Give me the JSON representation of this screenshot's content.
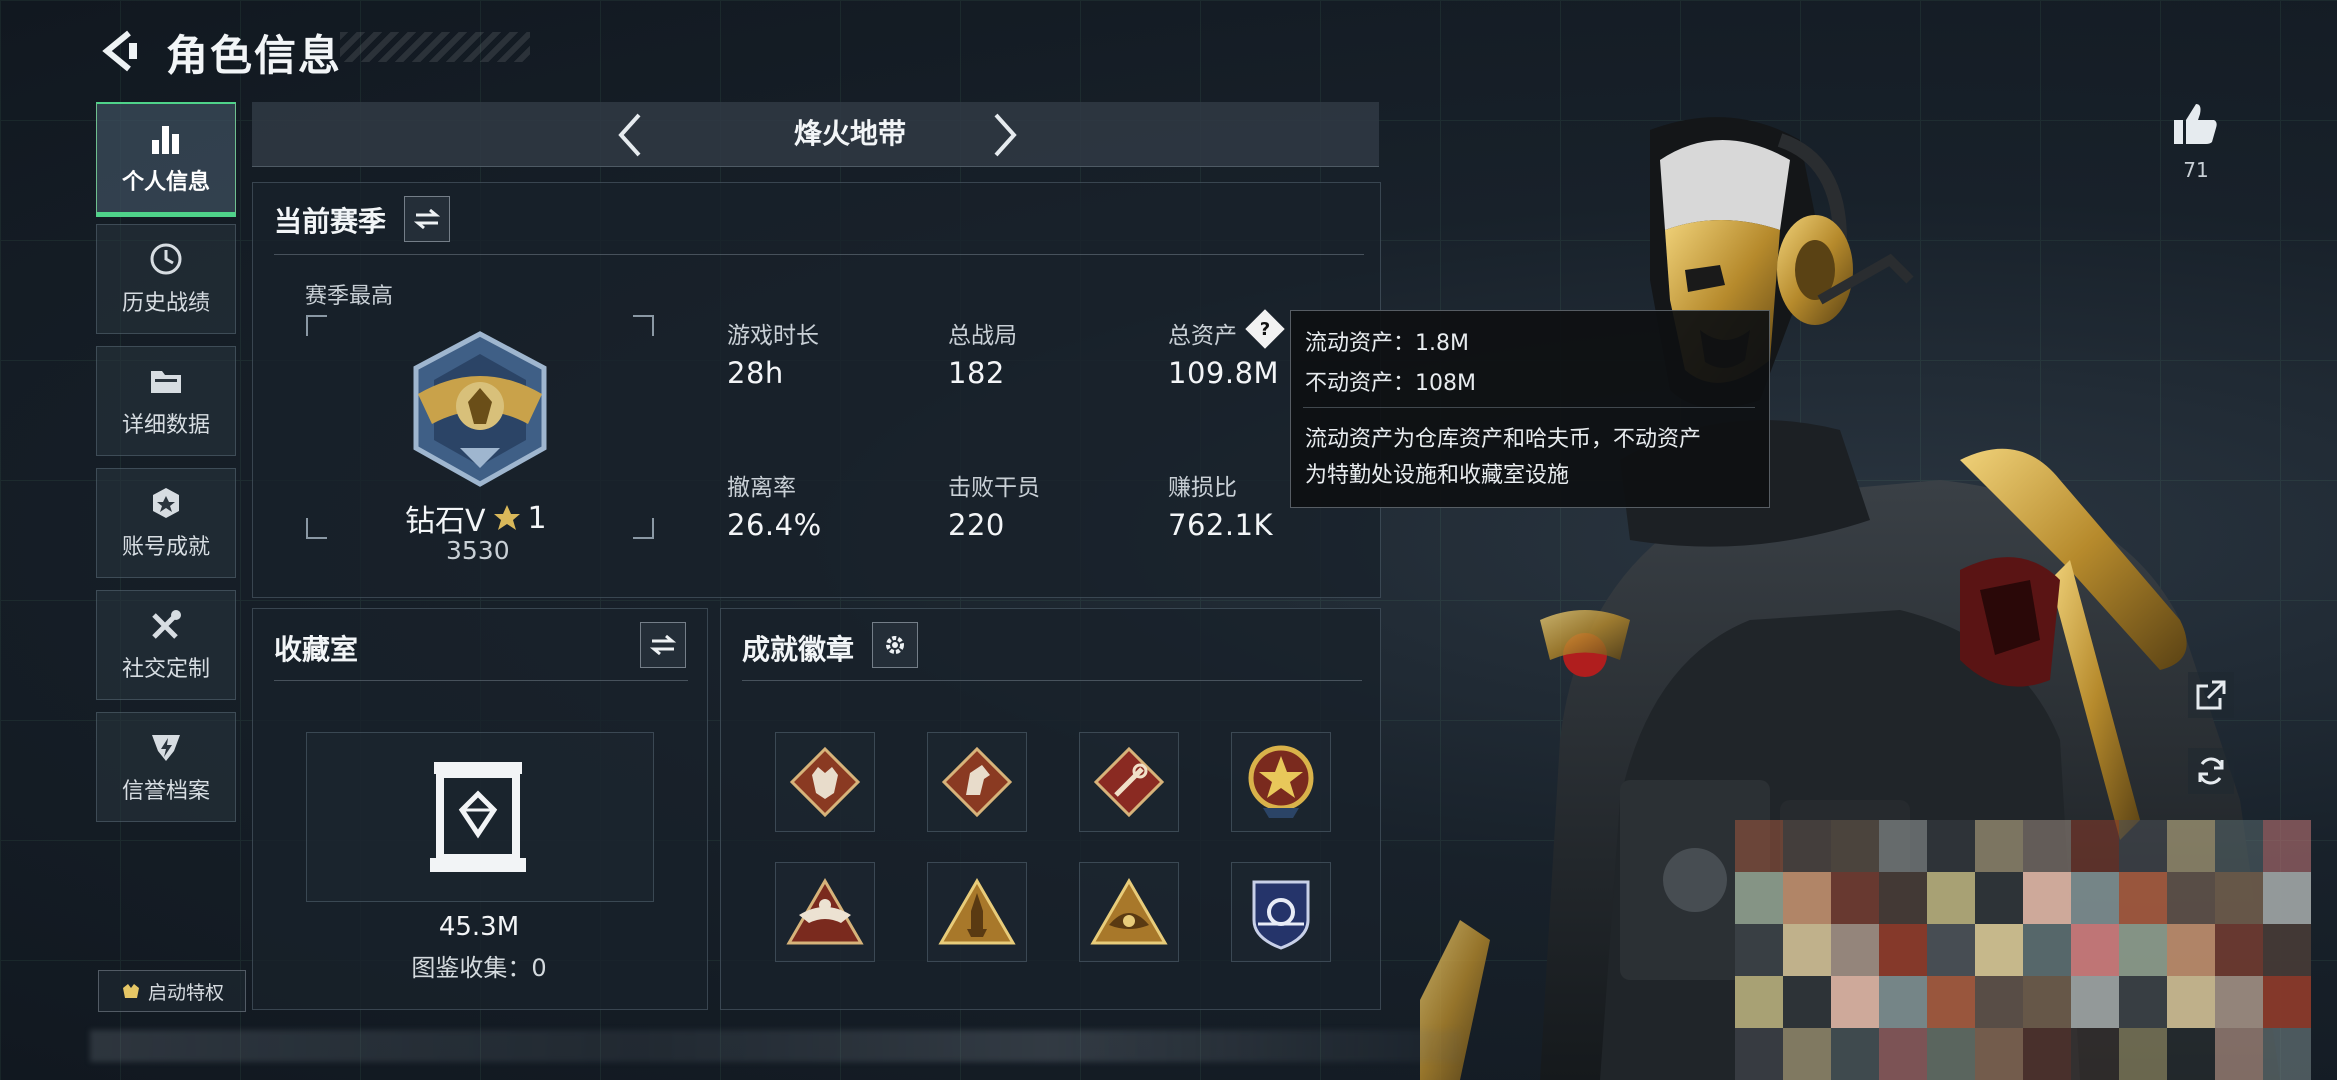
{
  "header": {
    "title": "角色信息"
  },
  "sidebar": {
    "items": [
      {
        "label": "个人信息",
        "icon": "bar-chart-icon",
        "active": true
      },
      {
        "label": "历史战绩",
        "icon": "history-clock-icon",
        "active": false
      },
      {
        "label": "详细数据",
        "icon": "folder-icon",
        "active": false
      },
      {
        "label": "账号成就",
        "icon": "achievement-icon",
        "active": false
      },
      {
        "label": "社交定制",
        "icon": "tools-icon",
        "active": false
      },
      {
        "label": "信誉档案",
        "icon": "reputation-icon",
        "active": false
      }
    ],
    "privilege_label": "启动特权"
  },
  "mode": {
    "label": "烽火地带"
  },
  "season": {
    "title": "当前赛季",
    "best_label": "赛季最高",
    "rank_name": "钻石V",
    "rank_stars": "1",
    "rank_points": "3530",
    "stats": [
      {
        "label": "游戏时长",
        "value": "28h"
      },
      {
        "label": "总战局",
        "value": "182"
      },
      {
        "label": "总资产",
        "value": "109.8M"
      },
      {
        "label": "撤离率",
        "value": "26.4%"
      },
      {
        "label": "击败干员",
        "value": "220"
      },
      {
        "label": "赚损比",
        "value": "762.1K"
      }
    ]
  },
  "tooltip": {
    "liquid": "流动资产：1.8M",
    "fixed": "不动资产：108M",
    "desc_line1": "流动资产为仓库资产和哈夫币，不动资产",
    "desc_line2": "为特勤处设施和收藏室设施"
  },
  "collection": {
    "title": "收藏室",
    "value": "45.3M",
    "catalog": "图鉴收集：0"
  },
  "badges": {
    "title": "成就徽章",
    "items": [
      "wolf-badge-icon",
      "horse-badge-icon",
      "tool-badge-icon",
      "star-medal-icon",
      "eagle-badge-icon",
      "rocket-badge-icon",
      "eye-badge-icon",
      "shield-badge-icon"
    ]
  },
  "likes": {
    "count": "71"
  },
  "colors": {
    "accent_green": "#4fd38a",
    "gold": "#c9a24a",
    "tooltip_bg": "#0e1012"
  }
}
